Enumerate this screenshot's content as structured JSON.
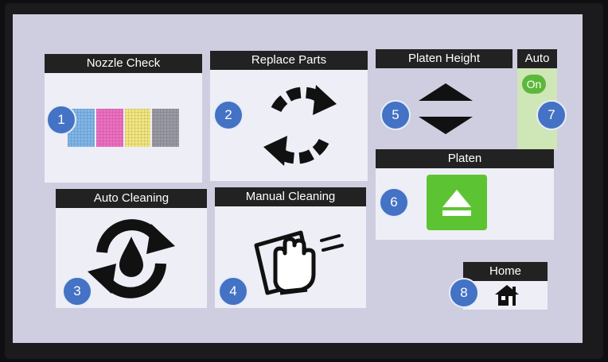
{
  "tiles": {
    "nozzle_check": {
      "label": "Nozzle Check",
      "badge": "1"
    },
    "replace_parts": {
      "label": "Replace Parts",
      "badge": "2"
    },
    "auto_cleaning": {
      "label": "Auto Cleaning",
      "badge": "3"
    },
    "manual_cleaning": {
      "label": "Manual Cleaning",
      "badge": "4"
    },
    "platen_height": {
      "label": "Platen Height",
      "badge": "5"
    },
    "platen": {
      "label": "Platen",
      "badge": "6"
    },
    "auto": {
      "label": "Auto",
      "toggle": "On",
      "badge": "7"
    },
    "home": {
      "label": "Home",
      "badge": "8"
    }
  },
  "colors": {
    "header": "#222222",
    "badge": "#4472c4",
    "platen_button": "#5cc433",
    "auto_toggle": "#5cb83a"
  },
  "icons": {
    "nozzle_check": "nozzle-pattern-icon",
    "replace_parts": "refresh-arrows-icon",
    "auto_cleaning": "cycle-drop-icon",
    "manual_cleaning": "wiping-glove-icon",
    "platen_height": "up-down-arrows-icon",
    "platen": "eject-icon",
    "home": "house-icon"
  }
}
